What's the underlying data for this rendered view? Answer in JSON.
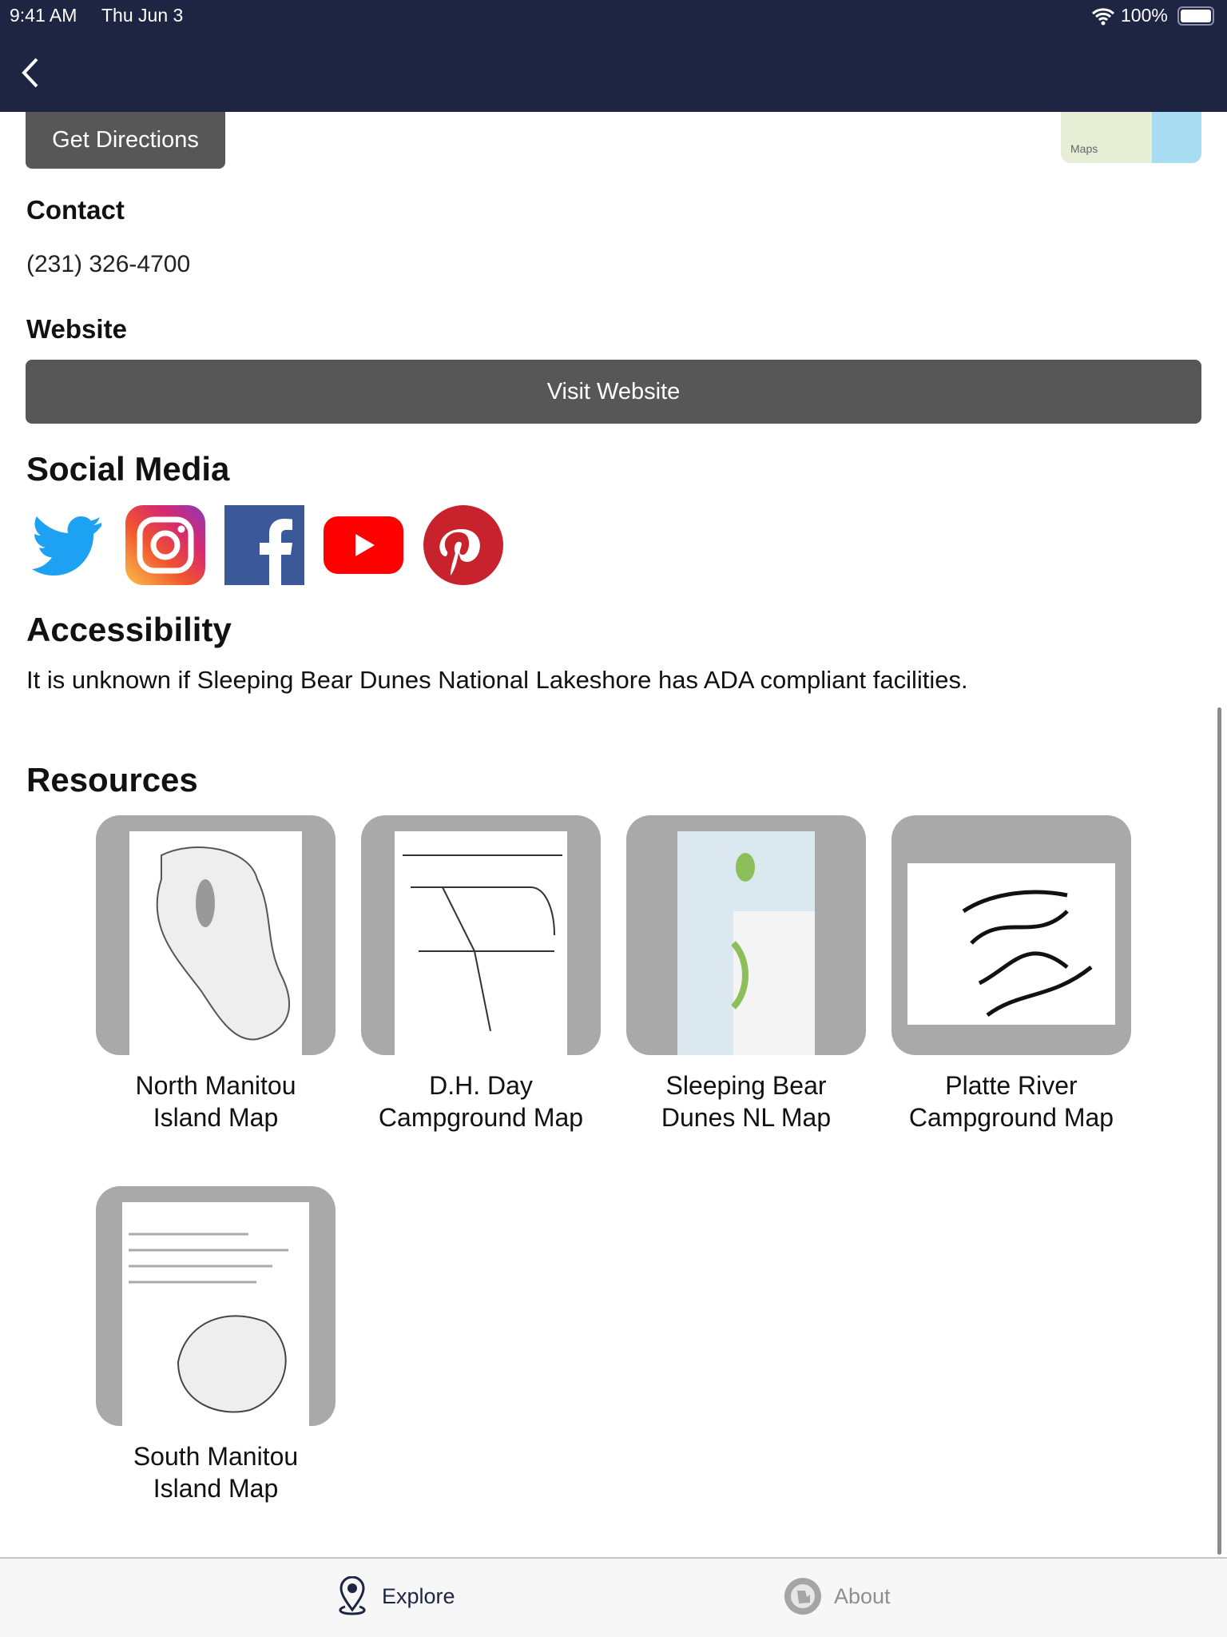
{
  "status_bar": {
    "time": "9:41 AM",
    "date": "Thu Jun 3",
    "battery": "100%"
  },
  "nav": {
    "back_icon": "chevron-left-icon"
  },
  "location": {
    "get_directions_label": "Get Directions",
    "map_attribution": "Maps"
  },
  "contact": {
    "heading": "Contact",
    "phone": "(231) 326-4700"
  },
  "website": {
    "heading": "Website",
    "button_label": "Visit Website"
  },
  "social": {
    "heading": "Social Media",
    "items": [
      {
        "name": "twitter",
        "color": "#1da1f2"
      },
      {
        "name": "instagram",
        "color": "#e1306c"
      },
      {
        "name": "facebook",
        "color": "#3b5998"
      },
      {
        "name": "youtube",
        "color": "#ff0000"
      },
      {
        "name": "pinterest",
        "color": "#c8232c"
      }
    ]
  },
  "accessibility": {
    "heading": "Accessibility",
    "text": "It is unknown if Sleeping Bear Dunes National Lakeshore has ADA compliant facilities."
  },
  "resources": {
    "heading": "Resources",
    "items": [
      {
        "line1": "North Manitou",
        "line2": "Island Map"
      },
      {
        "line1": "D.H. Day",
        "line2": "Campground Map"
      },
      {
        "line1": "Sleeping Bear",
        "line2": "Dunes NL Map"
      },
      {
        "line1": "Platte River",
        "line2": "Campground Map"
      },
      {
        "line1": "South Manitou",
        "line2": "Island Map"
      }
    ]
  },
  "tabs": [
    {
      "label": "Explore",
      "icon": "map-pin-icon",
      "active": true
    },
    {
      "label": "About",
      "icon": "explore-michigan-badge-icon",
      "active": false
    }
  ]
}
